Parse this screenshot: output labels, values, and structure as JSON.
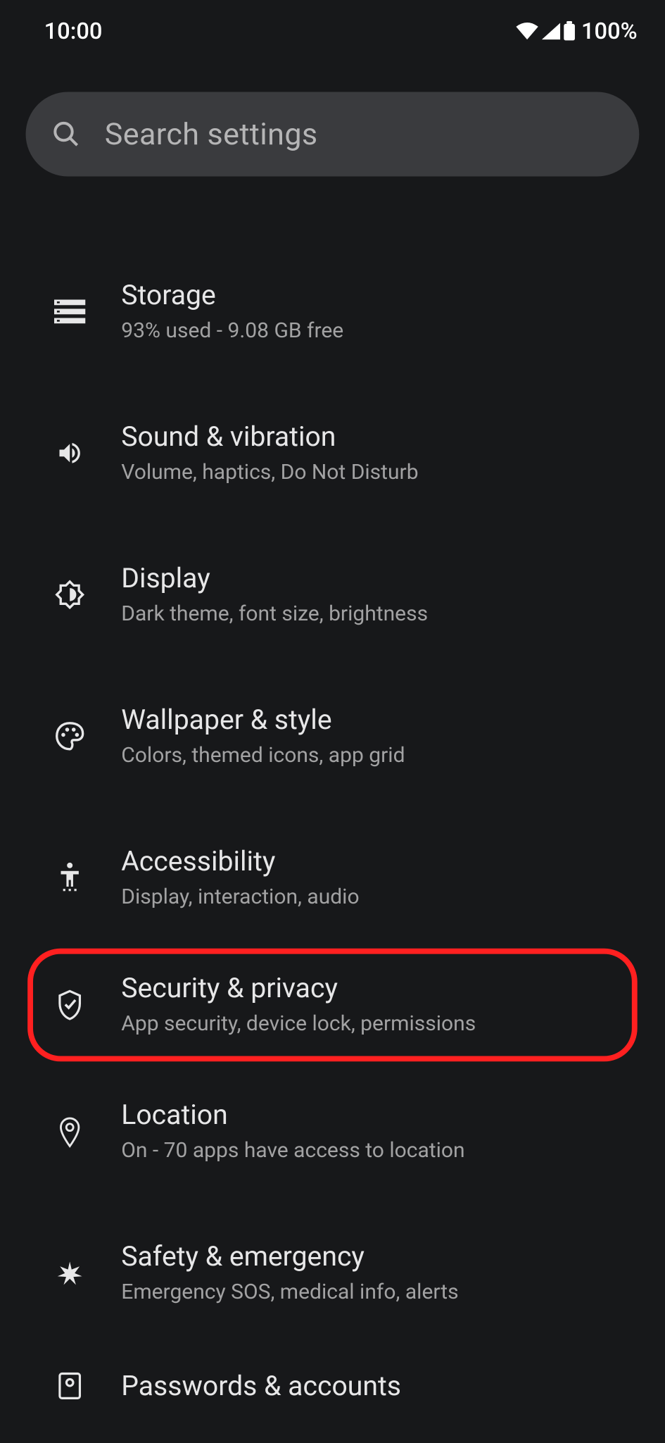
{
  "status_bar": {
    "time": "10:00",
    "battery_percent": "100%"
  },
  "search": {
    "placeholder": "Search settings"
  },
  "items": [
    {
      "title": "Storage",
      "subtitle": "93% used - 9.08 GB free"
    },
    {
      "title": "Sound & vibration",
      "subtitle": "Volume, haptics, Do Not Disturb"
    },
    {
      "title": "Display",
      "subtitle": "Dark theme, font size, brightness"
    },
    {
      "title": "Wallpaper & style",
      "subtitle": "Colors, themed icons, app grid"
    },
    {
      "title": "Accessibility",
      "subtitle": "Display, interaction, audio"
    },
    {
      "title": "Security & privacy",
      "subtitle": "App security, device lock, permissions"
    },
    {
      "title": "Location",
      "subtitle": "On - 70 apps have access to location"
    },
    {
      "title": "Safety & emergency",
      "subtitle": "Emergency SOS, medical info, alerts"
    },
    {
      "title": "Passwords & accounts",
      "subtitle": ""
    }
  ]
}
